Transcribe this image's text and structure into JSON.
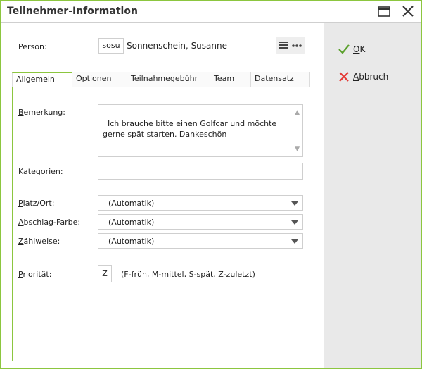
{
  "window": {
    "title": "Teilnehmer-Information"
  },
  "person": {
    "label": "Person:",
    "code": "sosu",
    "name": "Sonnenschein, Susanne"
  },
  "tabs": [
    {
      "label": "Allgemein",
      "active": true
    },
    {
      "label": "Optionen",
      "active": false
    },
    {
      "label": "Teilnahmegebühr",
      "active": false
    },
    {
      "label": "Team",
      "active": false
    },
    {
      "label": "Datensatz",
      "active": false
    }
  ],
  "form": {
    "bemerkung": {
      "label_first": "B",
      "label_rest": "emerkung:",
      "value": "Ich brauche bitte einen Golfcar und möchte\ngerne spät starten. Dankeschön"
    },
    "kategorien": {
      "label_first": "K",
      "label_rest": "ategorien:",
      "value": ""
    },
    "platz": {
      "label_first": "P",
      "label_rest": "latz/Ort:",
      "value": "(Automatik)"
    },
    "abschlag": {
      "label_first": "A",
      "label_rest": "bschlag-Farbe:",
      "value": "(Automatik)"
    },
    "zaehlweise": {
      "label_first": "Z",
      "label_rest": "ählweise:",
      "value": "(Automatik)"
    },
    "prioritaet": {
      "label_first": "P",
      "label_rest": "riorität:",
      "value": "Z",
      "hint": "(F-früh, M-mittel, S-spät, Z-zuletzt)"
    }
  },
  "actions": {
    "ok_first": "O",
    "ok_rest": "K",
    "cancel_first": "A",
    "cancel_rest": "bbruch"
  },
  "colors": {
    "accent": "#8cc63f",
    "ok_icon": "#5aa02c",
    "cancel_icon": "#e53935",
    "side_bg": "#e9e9e9"
  }
}
